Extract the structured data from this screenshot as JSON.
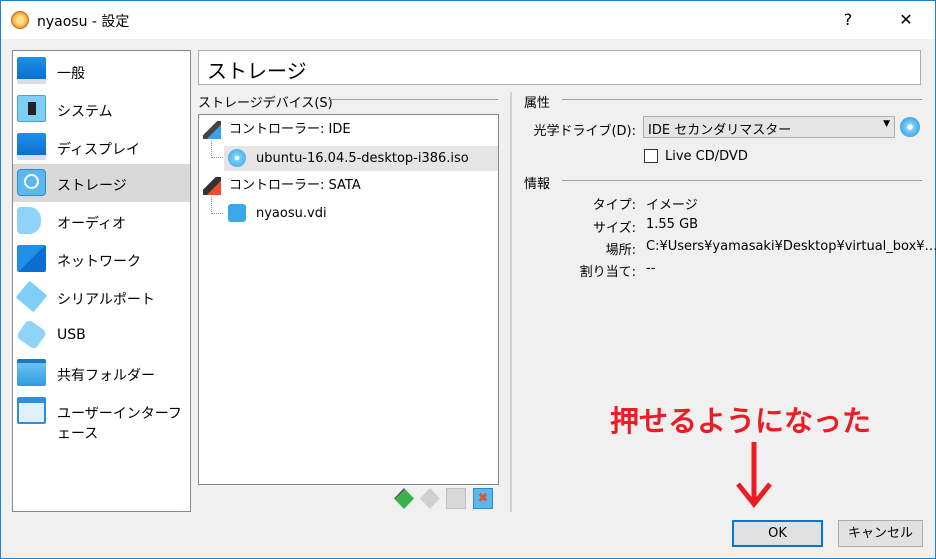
{
  "window": {
    "title": "nyaosu - 設定",
    "help": "?",
    "close": "✕"
  },
  "sidebar": {
    "items": [
      {
        "label": "一般",
        "icon": "monitor-icon"
      },
      {
        "label": "システム",
        "icon": "chip-icon"
      },
      {
        "label": "ディスプレイ",
        "icon": "display-icon"
      },
      {
        "label": "ストレージ",
        "icon": "storage-icon",
        "selected": true
      },
      {
        "label": "オーディオ",
        "icon": "speaker-icon"
      },
      {
        "label": "ネットワーク",
        "icon": "network-icon"
      },
      {
        "label": "シリアルポート",
        "icon": "serial-port-icon"
      },
      {
        "label": "USB",
        "icon": "usb-icon"
      },
      {
        "label": "共有フォルダー",
        "icon": "folder-icon"
      },
      {
        "label": "ユーザーインターフェース",
        "icon": "ui-icon"
      }
    ]
  },
  "page_title": "ストレージ",
  "storage": {
    "header": "ストレージデバイス(S)",
    "tree": [
      {
        "label": "コントローラー: IDE",
        "children": [
          "ubuntu-16.04.5-desktop-i386.iso"
        ]
      },
      {
        "label": "コントローラー: SATA",
        "children": [
          "nyaosu.vdi"
        ]
      }
    ]
  },
  "attributes": {
    "header": "属性",
    "optical_label": "光学ドライブ(D):",
    "optical_value": "IDE セカンダリマスター",
    "live_cd": "Live CD/DVD",
    "live_cd_checked": false
  },
  "info": {
    "header": "情報",
    "rows": [
      {
        "label": "タイプ:",
        "value": "イメージ"
      },
      {
        "label": "サイズ:",
        "value": "1.55 GB"
      },
      {
        "label": "場所:",
        "value": "C:¥Users¥yamasaki¥Desktop¥virtual_box¥…"
      },
      {
        "label": "割り当て:",
        "value": "--"
      }
    ]
  },
  "annotation": "押せるようになった",
  "buttons": {
    "ok": "OK",
    "cancel": "キャンセル"
  },
  "colors": {
    "accent": "#0078d7",
    "annotation": "#ed1c24"
  }
}
